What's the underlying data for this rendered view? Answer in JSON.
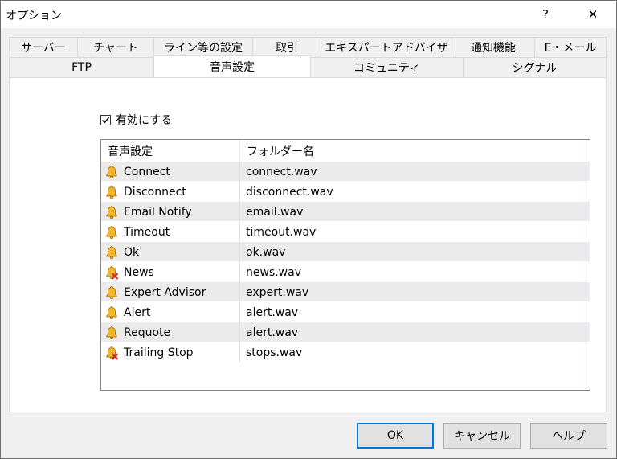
{
  "window": {
    "title": "オプション",
    "help_label": "?",
    "close_label": "✕"
  },
  "tabs_top": [
    {
      "label": "サーバー"
    },
    {
      "label": "チャート"
    },
    {
      "label": "ライン等の設定"
    },
    {
      "label": "取引"
    },
    {
      "label": "エキスパートアドバイザ"
    },
    {
      "label": "通知機能"
    },
    {
      "label": "E・メール"
    }
  ],
  "tabs_bottom": [
    {
      "label": "FTP"
    },
    {
      "label": "音声設定",
      "active": true
    },
    {
      "label": "コミュニティ"
    },
    {
      "label": "シグナル"
    }
  ],
  "enable": {
    "label": "有効にする",
    "checked": true
  },
  "list": {
    "headers": [
      "音声設定",
      "フォルダー名"
    ],
    "rows": [
      {
        "event": "Connect",
        "file": "connect.wav",
        "icon": "bell-icon"
      },
      {
        "event": "Disconnect",
        "file": "disconnect.wav",
        "icon": "bell-icon"
      },
      {
        "event": "Email Notify",
        "file": "email.wav",
        "icon": "bell-icon"
      },
      {
        "event": "Timeout",
        "file": "timeout.wav",
        "icon": "bell-icon"
      },
      {
        "event": "Ok",
        "file": "ok.wav",
        "icon": "bell-icon"
      },
      {
        "event": "News",
        "file": "news.wav",
        "icon": "bell-disabled-icon"
      },
      {
        "event": "Expert Advisor",
        "file": "expert.wav",
        "icon": "bell-icon"
      },
      {
        "event": "Alert",
        "file": "alert.wav",
        "icon": "bell-icon"
      },
      {
        "event": "Requote",
        "file": "alert.wav",
        "icon": "bell-icon"
      },
      {
        "event": "Trailing Stop",
        "file": "stops.wav",
        "icon": "bell-disabled-icon"
      }
    ]
  },
  "buttons": {
    "ok": "OK",
    "cancel": "キャンセル",
    "help": "ヘルプ"
  },
  "colors": {
    "bell": "#f2b72a",
    "disabled_x": "#d4262a",
    "default_button_border": "#0078d7"
  }
}
